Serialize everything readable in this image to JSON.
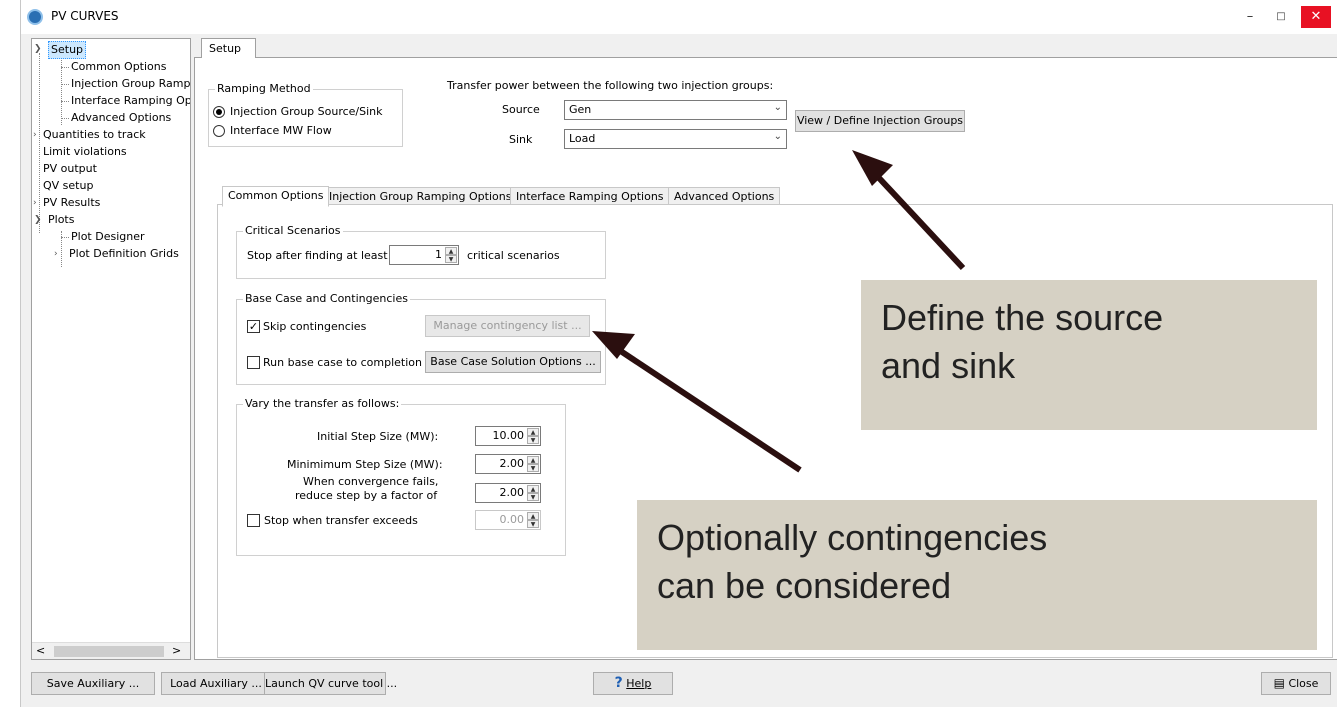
{
  "window": {
    "title": "PV CURVES",
    "min_icon": "minimize-icon",
    "max_icon": "maximize-icon",
    "close_icon": "close-icon"
  },
  "tree": {
    "items": [
      {
        "label": "Setup",
        "level": 0,
        "expanded": true,
        "selected": true
      },
      {
        "label": "Common Options",
        "level": 1
      },
      {
        "label": "Injection Group Ramp",
        "level": 1
      },
      {
        "label": "Interface Ramping Op",
        "level": 1
      },
      {
        "label": "Advanced Options",
        "level": 1
      },
      {
        "label": "Quantities to track",
        "level": 0,
        "collapsed": true
      },
      {
        "label": "Limit violations",
        "level": 0
      },
      {
        "label": "PV output",
        "level": 0
      },
      {
        "label": "QV setup",
        "level": 0
      },
      {
        "label": "PV Results",
        "level": 0,
        "collapsed": true
      },
      {
        "label": "Plots",
        "level": 0,
        "expanded": true
      },
      {
        "label": "Plot Designer",
        "level": 1
      },
      {
        "label": "Plot Definition Grids",
        "level": 1,
        "collapsed": true
      }
    ]
  },
  "main_tab": "Setup",
  "ramping": {
    "group_title": "Ramping Method",
    "option1": "Injection Group Source/Sink",
    "option2": "Interface MW Flow",
    "selected": "Injection Group Source/Sink"
  },
  "transfer": {
    "heading": "Transfer power between the following two injection groups:",
    "source_label": "Source",
    "source_value": "Gen",
    "sink_label": "Sink",
    "sink_value": "Load",
    "view_button": "View / Define Injection Groups"
  },
  "sub_tabs": [
    "Common Options",
    "Injection Group Ramping Options",
    "Interface Ramping Options",
    "Advanced Options"
  ],
  "critical": {
    "title": "Critical Scenarios",
    "prefix": "Stop after finding at least",
    "value": "1",
    "suffix": "critical scenarios"
  },
  "base_case": {
    "title": "Base Case and Contingencies",
    "skip_label": "Skip contingencies",
    "skip_checked": true,
    "manage_button": "Manage contingency list ...",
    "run_label": "Run base case to completion",
    "run_checked": false,
    "solution_button": "Base Case Solution Options ..."
  },
  "vary": {
    "title": "Vary the transfer as follows:",
    "initial_label": "Initial Step Size (MW):",
    "initial_value": "10.00",
    "minimum_label": "Minimimum Step Size (MW):",
    "minimum_value": "2.00",
    "convergence_label1": "When convergence fails,",
    "convergence_label2": "reduce step by a factor of",
    "convergence_value": "2.00",
    "stop_label": "Stop when transfer exceeds",
    "stop_value": "0.00",
    "stop_checked": false
  },
  "callouts": {
    "source": {
      "line1": "Define the source",
      "line2": "and sink"
    },
    "contingencies": {
      "line1": "Optionally contingencies",
      "line2": "can be considered"
    }
  },
  "bottom": {
    "save": "Save Auxiliary ...",
    "load": "Load Auxiliary ...",
    "launch": "Launch QV curve tool ...",
    "help": "Help",
    "close": "Close"
  },
  "colors": {
    "callout_bg": "#d6d1c4",
    "arrow": "#2b0f0f",
    "selection": "#cce8ff"
  }
}
